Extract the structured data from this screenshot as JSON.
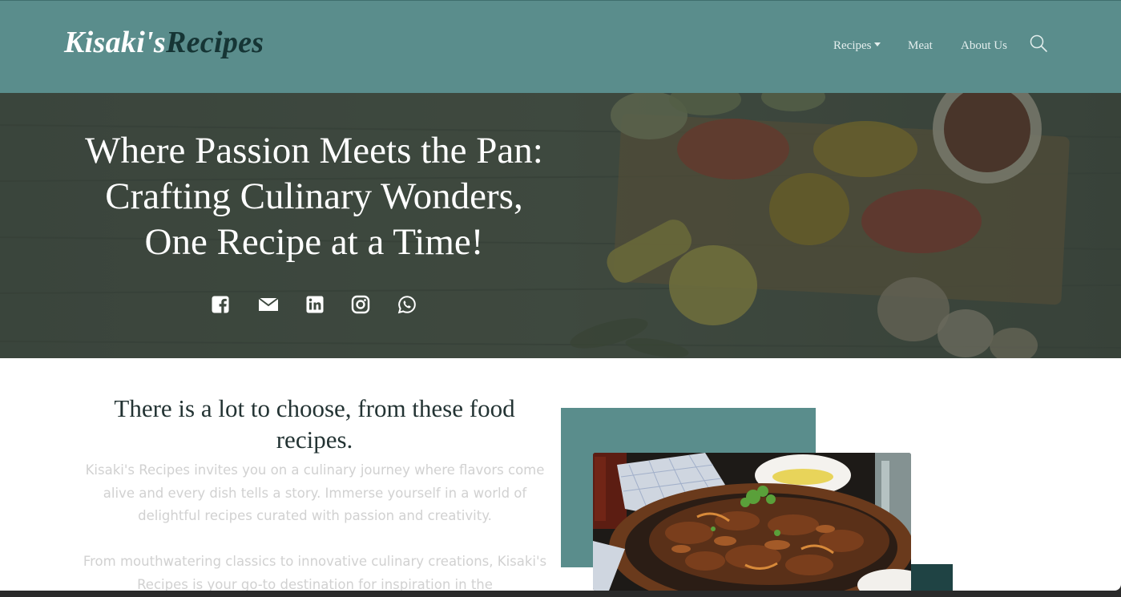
{
  "brand": {
    "part1": "Kisaki's",
    "part2": "Recipes"
  },
  "nav": {
    "recipes_label": "Recipes",
    "meat_label": "Meat",
    "about_label": "About Us",
    "search_icon": "search-icon"
  },
  "hero": {
    "title_lines": [
      "Where Passion Meets the Pan:",
      "Crafting Culinary Wonders,",
      "One Recipe at a Time!"
    ],
    "social_icons": [
      "facebook-icon",
      "envelope-icon",
      "linkedin-icon",
      "instagram-icon",
      "whatsapp-icon"
    ]
  },
  "content": {
    "heading": "There is a lot to choose, from these food recipes.",
    "paragraph1": "Kisaki's Recipes invites you on a culinary journey where flavors come alive and every dish tells a story. Immerse yourself in a world of delightful recipes curated with passion and creativity.",
    "paragraph2": "From mouthwatering classics to innovative culinary creations, Kisaki's Recipes is your go-to destination for inspiration in the"
  },
  "colors": {
    "navbar": "#5a8d8c",
    "brand_dark": "#163535",
    "accent_dark": "#1f4344",
    "heading": "#233333",
    "paragraph": "#d1d1d1"
  }
}
